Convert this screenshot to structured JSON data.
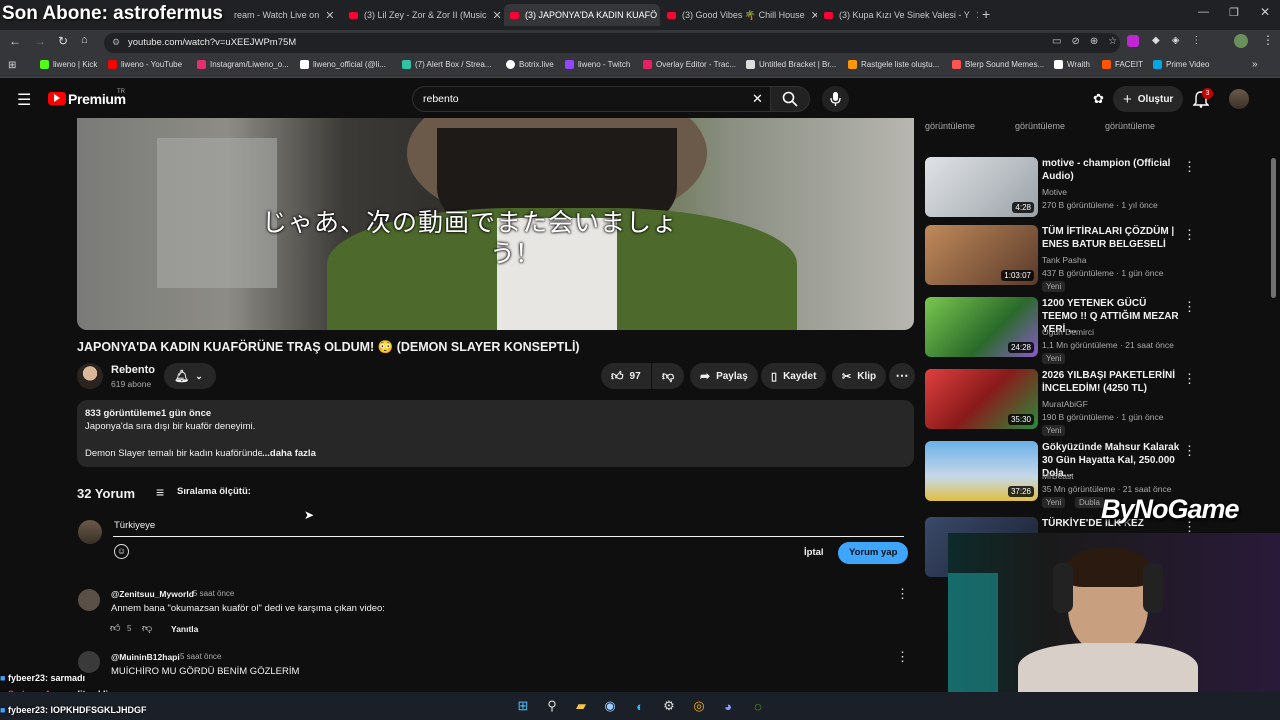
{
  "browser": {
    "tabs": [
      {
        "label": "Kick",
        "active": false
      },
      {
        "label": "(3) Lil Zey - Zor & Zor II (Music",
        "active": false
      },
      {
        "label": "(3) JAPONYA'DA KADIN KUAFÖ",
        "active": true
      },
      {
        "label": "(3) Good Vibes 🌴 Chill House",
        "active": false
      },
      {
        "label": "(3) Kupa Kızı Ve Sinek Valesi - Y",
        "active": false
      }
    ],
    "stream_tab": "ream - Watch Live on",
    "url": "youtube.com/watch?v=uXEEJWPm75M",
    "bookmarks": [
      {
        "label": "liweno | Kick",
        "color": "#53fc18"
      },
      {
        "label": "liweno - YouTube",
        "color": "#ff0000"
      },
      {
        "label": "Instagram/Liweno_o...",
        "color": "#e1306c"
      },
      {
        "label": "liweno_official (@li...",
        "color": "#ffffff"
      },
      {
        "label": "(7) Alert Box / Strea...",
        "color": "#31c3a2"
      },
      {
        "label": "Botrix.live",
        "color": "#ffffff"
      },
      {
        "label": "liweno - Twitch",
        "color": "#9146ff"
      },
      {
        "label": "Overlay Editor - Trac...",
        "color": "#e91e63"
      },
      {
        "label": "Untitled Bracket | Br...",
        "color": "#dddddd"
      },
      {
        "label": "Rastgele liste oluştu...",
        "color": "#ff9800"
      },
      {
        "label": "Blerp Sound Memes...",
        "color": "#ff5252"
      },
      {
        "label": "Wraith",
        "color": "#ffffff"
      },
      {
        "label": "FACEIT",
        "color": "#ff5500"
      },
      {
        "label": "Prime Video",
        "color": "#00a8e1"
      }
    ]
  },
  "overlay": {
    "follow_text": "Son Abone: astrofermus",
    "brand": "ByNoGame"
  },
  "youtube": {
    "logo": "Premium",
    "region": "TR",
    "search_value": "rebento",
    "create_label": "Oluştur",
    "notif_count": "3"
  },
  "video": {
    "subtitle_line1": "じゃあ、次の動画でまた会いましょ",
    "subtitle_line2": "う！",
    "title": "JAPONYA'DA KADIN KUAFÖRÜNE TRAŞ OLDUM! 😳 (DEMON SLAYER KONSEPTLİ)",
    "channel": "Rebento",
    "subscribers": "619 abone",
    "likes": "97",
    "share": "Paylaş",
    "save": "Kaydet",
    "clip": "Klip"
  },
  "description": {
    "views": "833 görüntüleme",
    "date": "1 gün önce",
    "line1": "Japonya'da sıra dışı bir kuaför deneyimi.",
    "line2": "Demon Slayer temalı bir kadın kuaföründe...",
    "more": "...daha fazla"
  },
  "comments": {
    "count": "32 Yorum",
    "sort_label": "Sıralama ölçütü:",
    "draft": "Türkiyeye",
    "cancel": "İptal",
    "submit": "Yorum yap",
    "items": [
      {
        "author": "@Zenitsuu_Myworld",
        "time": "5 saat önce",
        "text": "Annem bana \"okumazsan kuaför ol\" dedi ve karşıma çıkan video:",
        "likes": "5",
        "reply": "Yanıtla"
      },
      {
        "author": "@MuininB12hapi",
        "time": "5 saat önce",
        "text": "MUİCHİRO MU GÖRDÜ BENİM GÖZLERİM"
      }
    ]
  },
  "sidebar": {
    "top_views": [
      "görüntüleme",
      "görüntüleme",
      "görüntüleme"
    ],
    "items": [
      {
        "title": "motive - champion (Official Audio)",
        "channel": "Motive",
        "meta": "270 B görüntüleme · 1 yıl önce",
        "duration": "4:28",
        "badge": "",
        "thumb": "#cfd4d8"
      },
      {
        "title": "TÜM İFTİRALARI ÇÖZDÜM | ENES BATUR BELGESELİ",
        "channel": "Tank Pasha",
        "meta": "437 B görüntüleme · 1 gün önce",
        "duration": "1:03:07",
        "badge": "Yeni",
        "thumb": "#8a6a4a"
      },
      {
        "title": "1200 YETENEK GÜCÜ TEEMO !! Q ATTIĞIM MEZAR YERİ ...",
        "channel": "Ogün Demirci",
        "meta": "1,1 Mn görüntüleme · 21 saat önce",
        "duration": "24:28",
        "badge": "Yeni",
        "thumb": "#4b8a3a"
      },
      {
        "title": "2026 YILBAŞI PAKETLERİNİ İNCELEDİM! (4250 TL)",
        "channel": "MuratAbiGF",
        "meta": "190 B görüntüleme · 1 gün önce",
        "duration": "35:30",
        "badge": "Yeni",
        "thumb": "#c0392b"
      },
      {
        "title": "Gökyüzünde Mahsur Kalarak 30 Gün Hayatta Kal, 250.000 Dola...",
        "channel": "MrBeast",
        "meta": "35 Mn görüntüleme · 21 saat önce",
        "duration": "37:26",
        "badge": "Yeni",
        "thumb": "#3a7ab8"
      },
      {
        "title": "TÜRKİYE'DE İLK KEZ",
        "channel": "",
        "meta": "",
        "duration": "",
        "badge": "",
        "thumb": "#2a3a5a"
      }
    ],
    "dublaj": "Dubla"
  },
  "chat": [
    {
      "user": "fybeer23",
      "msg": ": sarmadı"
    },
    {
      "user": "Sadece_Azra",
      "msg": ": edit şekli"
    },
    {
      "user": "fybeer23",
      "msg": ": IOPKHDFSGKLJHDGF"
    }
  ]
}
